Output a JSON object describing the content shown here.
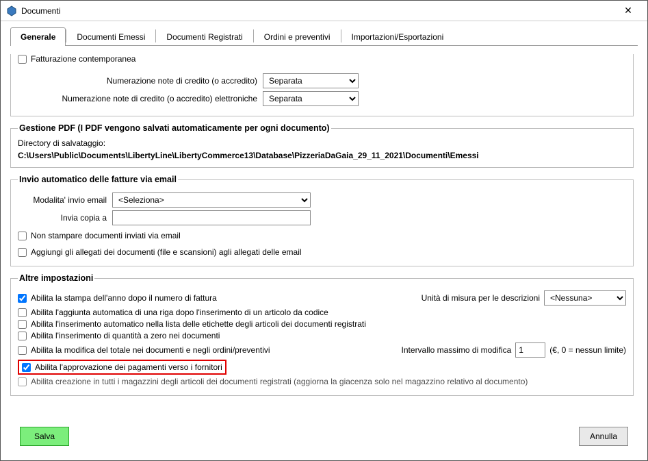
{
  "window": {
    "title": "Documenti",
    "close_glyph": "✕"
  },
  "tabs": [
    {
      "label": "Generale",
      "active": true
    },
    {
      "label": "Documenti Emessi",
      "active": false
    },
    {
      "label": "Documenti Registrati",
      "active": false
    },
    {
      "label": "Ordini e preventivi",
      "active": false
    },
    {
      "label": "Importazioni/Esportazioni",
      "active": false
    }
  ],
  "numerazione": {
    "fatt_contemporanea_label": "Fatturazione contemporanea",
    "fatt_contemporanea_checked": false,
    "note_credito_label": "Numerazione note di credito (o accredito)",
    "note_credito_value": "Separata",
    "note_credito_elettr_label": "Numerazione note di credito (o accredito) elettroniche",
    "note_credito_elettr_value": "Separata"
  },
  "gestione_pdf": {
    "legend": "Gestione PDF (I PDF vengono salvati automaticamente per ogni documento)",
    "dir_label": "Directory di salvataggio:",
    "dir_value": "C:\\Users\\Public\\Documents\\LibertyLine\\LibertyCommerce13\\Database\\PizzeriaDaGaia_29_11_2021\\Documenti\\Emessi"
  },
  "invio_email": {
    "legend": "Invio automatico delle fatture via email",
    "modalita_label": "Modalita' invio email",
    "modalita_value": "<Seleziona>",
    "copia_label": "Invia copia a",
    "copia_value": "",
    "non_stampare_label": "Non stampare documenti inviati via email",
    "non_stampare_checked": false,
    "aggiungi_allegati_label": "Aggiungi gli allegati dei documenti (file e scansioni) agli allegati delle email",
    "aggiungi_allegati_checked": false
  },
  "altre": {
    "legend": "Altre impostazioni",
    "rows": [
      {
        "label": "Abilita la stampa dell'anno dopo il numero di fattura",
        "checked": true
      },
      {
        "label": "Abilita l'aggiunta automatica di una riga dopo l'inserimento di un articolo da codice",
        "checked": false
      },
      {
        "label": "Abilita l'inserimento automatico nella lista delle etichette degli articoli dei documenti registrati",
        "checked": false
      },
      {
        "label": "Abilita l'inserimento di quantità a zero nei documenti",
        "checked": false
      },
      {
        "label": "Abilita la modifica del totale nei documenti e negli ordini/preventivi",
        "checked": false
      },
      {
        "label": "Abilita l'approvazione dei pagamenti verso i fornitori",
        "checked": true,
        "highlighted": true
      },
      {
        "label": "Abilita creazione in tutti i magazzini degli articoli dei documenti registrati (aggiorna la giacenza solo nel magazzino relativo al documento)",
        "checked": false
      }
    ],
    "unita_misura_label": "Unità di misura per le descrizioni",
    "unita_misura_value": "<Nessuna>",
    "intervallo_label": "Intervallo massimo di modifica",
    "intervallo_value": "1",
    "intervallo_hint": "(€, 0 = nessun limite)"
  },
  "footer": {
    "save_label": "Salva",
    "cancel_label": "Annulla"
  }
}
